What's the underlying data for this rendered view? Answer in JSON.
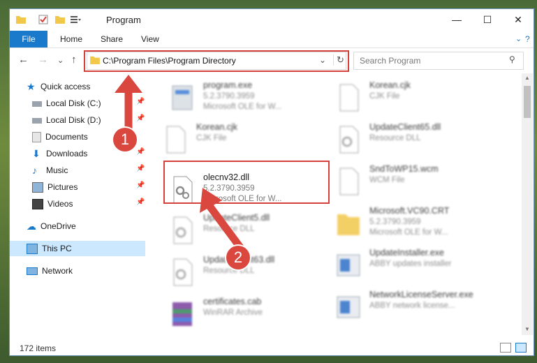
{
  "window": {
    "title": "Program"
  },
  "ribbon": {
    "file": "File",
    "tabs": [
      "Home",
      "Share",
      "View"
    ]
  },
  "address": {
    "path": "C:\\Program Files\\Program Directory"
  },
  "search": {
    "placeholder": "Search Program"
  },
  "nav": {
    "quick_access": "Quick access",
    "items": [
      "Local Disk (C:)",
      "Local Disk (D:)",
      "Documents",
      "Downloads",
      "Music",
      "Pictures",
      "Videos"
    ],
    "onedrive": "OneDrive",
    "this_pc": "This PC",
    "network": "Network"
  },
  "files": [
    {
      "name": "program.exe",
      "line2": "5.2.3790.3959",
      "line3": "Microsoft OLE for W..."
    },
    {
      "name": "Korean.cjk",
      "line2": "CJK File",
      "line3": ""
    },
    {
      "name": "Korean.cjk",
      "line2": "CJK File",
      "line3": ""
    },
    {
      "name": "UpdateClient65.dll",
      "line2": "Resource DLL",
      "line3": ""
    },
    {
      "name": "olecnv32.dll",
      "line2": "5.2.3790.3959",
      "line3": "Microsoft OLE for W..."
    },
    {
      "name": "SndToWP15.wcm",
      "line2": "WCM File",
      "line3": ""
    },
    {
      "name": "UpdateClient5.dll",
      "line2": "Resource DLL",
      "line3": ""
    },
    {
      "name": "Microsoft.VC90.CRT",
      "line2": "5.2.3790.3959",
      "line3": "Microsoft OLE for W..."
    },
    {
      "name": "UpdateClient63.dll",
      "line2": "Resource DLL",
      "line3": ""
    },
    {
      "name": "UpdateInstaller.exe",
      "line2": "ABBY updates installer",
      "line3": ""
    },
    {
      "name": "certificates.cab",
      "line2": "WinRAR Archive",
      "line3": ""
    },
    {
      "name": "NetworkLicenseServer.exe",
      "line2": "ABBY network license...",
      "line3": ""
    }
  ],
  "status": {
    "count": "172 items"
  },
  "annotations": {
    "badge1": "1",
    "badge2": "2"
  },
  "colors": {
    "accent": "#1979ca",
    "highlight": "#d6403a",
    "selected": "#cce8ff"
  }
}
